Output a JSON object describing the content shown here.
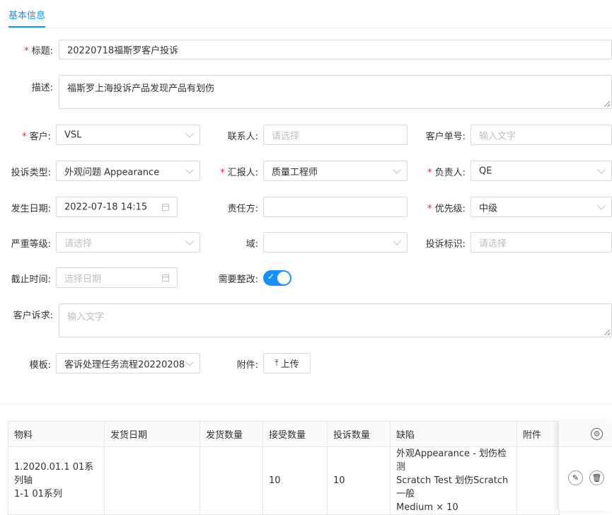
{
  "tabs": [
    {
      "label": "基本信息",
      "active": true
    }
  ],
  "form": {
    "title": {
      "label": "标题:",
      "required": true,
      "value": "20220718福斯罗客户投诉"
    },
    "description": {
      "label": "描述:",
      "value": "福斯罗上海投诉产品发现产品有划伤"
    },
    "customer": {
      "label": "客户:",
      "required": true,
      "value": "VSL"
    },
    "contact": {
      "label": "联系人:",
      "placeholder": "请选择"
    },
    "customer_order_no": {
      "label": "客户单号:",
      "placeholder": "输入文字"
    },
    "complaint_type": {
      "label": "投诉类型:",
      "value": "外观问题 Appearance"
    },
    "reporter": {
      "label": "汇报人:",
      "required": true,
      "value": "质量工程师"
    },
    "owner": {
      "label": "负责人:",
      "required": true,
      "value": "QE"
    },
    "occur_date": {
      "label": "发生日期:",
      "value": "2022-07-18 14:15"
    },
    "responsible_party": {
      "label": "责任方:",
      "value": ""
    },
    "priority": {
      "label": "优先级:",
      "required": true,
      "value": "中级"
    },
    "severity": {
      "label": "严重等级:",
      "placeholder": "请选择"
    },
    "domain": {
      "label": "域:",
      "value": ""
    },
    "complaint_tag": {
      "label": "投诉标识:",
      "placeholder": "请选择"
    },
    "deadline": {
      "label": "截止时间:",
      "placeholder": "选择日期"
    },
    "needs_rectification": {
      "label": "需要整改:",
      "checked": true,
      "check_glyph": "✓"
    },
    "customer_demand": {
      "label": "客户诉求:",
      "placeholder": "输入文字"
    },
    "template": {
      "label": "模板:",
      "value": "客诉处理任务流程20220208"
    },
    "attachment": {
      "label": "附件:",
      "button": "上传",
      "icon": "upload-icon"
    }
  },
  "table": {
    "headers": [
      "物料",
      "发货日期",
      "发货数量",
      "接受数量",
      "投诉数量",
      "缺陷",
      "附件"
    ],
    "rows": [
      {
        "material_line1": "1.2020.01.1 01系列轴",
        "material_line2": "1-1 01系列",
        "ship_date": "",
        "ship_qty": "",
        "accepted_qty": "10",
        "complaint_qty": "10",
        "defect_line1": "外观Appearance - 划伤检测",
        "defect_line2": "Scratch Test 划伤Scratch 一般",
        "defect_line3": "Medium × 10",
        "attachment": ""
      }
    ],
    "icons": {
      "settings": "gear-icon",
      "edit": "edit-icon",
      "delete": "trash-icon"
    }
  },
  "colors": {
    "accent": "#1890ff",
    "required": "#f5222d",
    "border": "#d9d9d9",
    "placeholder": "#bfbfbf"
  }
}
